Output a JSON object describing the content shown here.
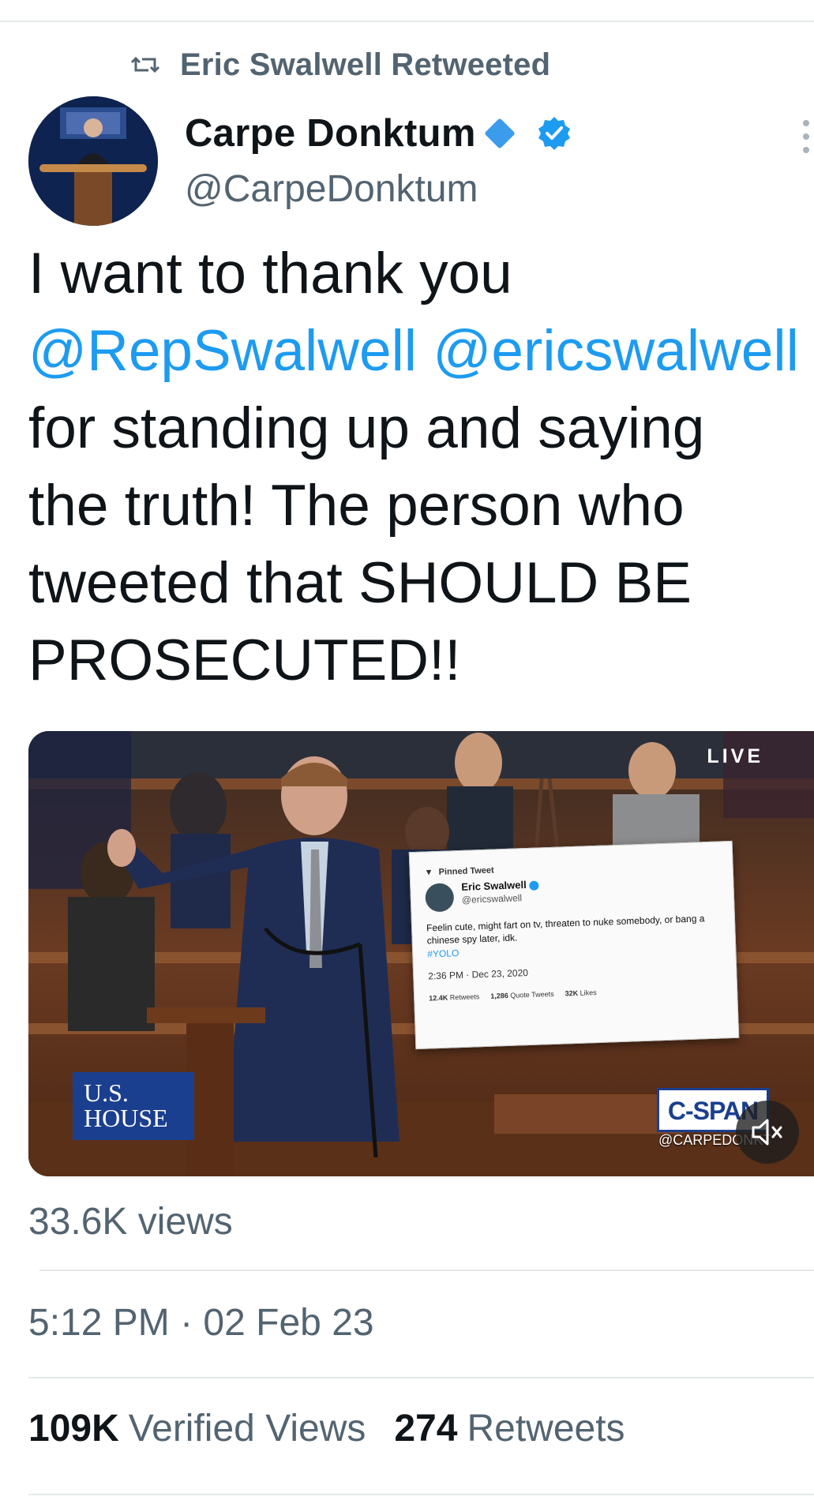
{
  "retweet_context": {
    "text": "Eric Swalwell Retweeted",
    "icon": "retweet-icon"
  },
  "author": {
    "display_name": "Carpe Donktum",
    "handle": "@CarpeDonktum",
    "badges": [
      "diamond-icon",
      "verified-icon"
    ]
  },
  "tweet": {
    "lines": [
      {
        "segments": [
          {
            "text": "I want to thank you",
            "type": "text"
          }
        ]
      },
      {
        "segments": [
          {
            "text": "@RepSwalwell",
            "type": "mention"
          },
          {
            "text": " ",
            "type": "text"
          },
          {
            "text": "@ericswalwell",
            "type": "mention"
          }
        ]
      },
      {
        "segments": [
          {
            "text": "for standing up and saying",
            "type": "text"
          }
        ]
      },
      {
        "segments": [
          {
            "text": "the truth! The person who",
            "type": "text"
          }
        ]
      },
      {
        "segments": [
          {
            "text": "tweeted that SHOULD BE",
            "type": "text"
          }
        ]
      },
      {
        "segments": [
          {
            "text": "PROSECUTED!!",
            "type": "text"
          }
        ]
      }
    ],
    "mention_color": "#1d9bf0"
  },
  "media": {
    "live_label": "LIVE",
    "network_bug": [
      "U.S.",
      "HOUSE"
    ],
    "channel_bug": "C-SPAN",
    "watermark": "@CARPEDONKT",
    "pinned_card": {
      "pinned_label": "Pinned Tweet",
      "name": "Eric Swalwell",
      "handle": "@ericswalwell",
      "text": "Feelin cute, might fart on tv, threaten to nuke somebody, or bang a chinese spy later, idk.",
      "hashtag": "#YOLO",
      "time": "2:36 PM · Dec 23, 2020",
      "retweets_num": "12.4K",
      "retweets_label": "Retweets",
      "quotes_num": "1,286",
      "quotes_label": "Quote Tweets",
      "likes_num": "32K",
      "likes_label": "Likes"
    },
    "mute_icon": "speaker-muted-icon"
  },
  "views": "33.6K views",
  "timestamp": "5:12 PM · 02 Feb 23",
  "stats": {
    "verified_views_num": "109K",
    "verified_views_label": "Verified Views",
    "retweets_num": "274",
    "retweets_label": "Retweets"
  },
  "colors": {
    "accent": "#1d9bf0",
    "secondary_text": "#536471",
    "primary_text": "#0f1419"
  }
}
